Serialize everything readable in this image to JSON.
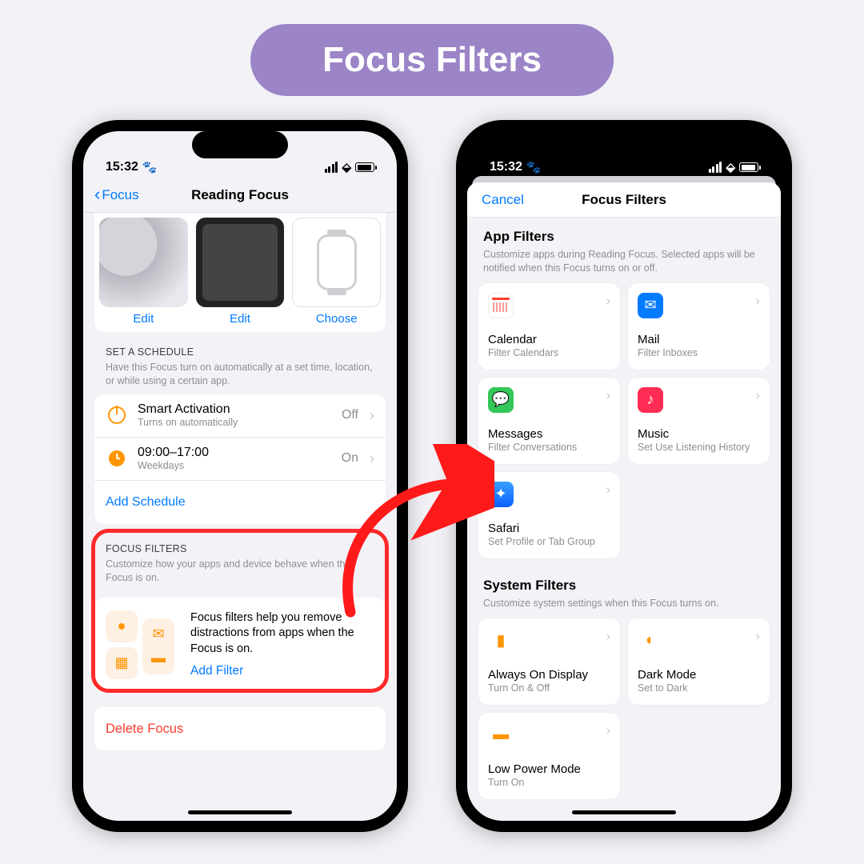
{
  "banner": "Focus Filters",
  "status_time": "15:32",
  "left": {
    "nav_back": "Focus",
    "nav_title": "Reading Focus",
    "previews": {
      "edit": "Edit",
      "choose": "Choose"
    },
    "schedule": {
      "header": "SET A SCHEDULE",
      "desc": "Have this Focus turn on automatically at a set time, location, or while using a certain app.",
      "smart": {
        "title": "Smart Activation",
        "sub": "Turns on automatically",
        "value": "Off"
      },
      "time": {
        "title": "09:00–17:00",
        "sub": "Weekdays",
        "value": "On"
      },
      "add": "Add Schedule"
    },
    "focus_filters": {
      "header": "FOCUS FILTERS",
      "desc": "Customize how your apps and device behave when this Focus is on.",
      "card_text": "Focus filters help you remove distractions from apps when the Focus is on.",
      "add": "Add Filter"
    },
    "delete": "Delete Focus"
  },
  "right": {
    "nav_cancel": "Cancel",
    "nav_title": "Focus Filters",
    "app_filters": {
      "title": "App Filters",
      "desc": "Customize apps during Reading Focus. Selected apps will be notified when this Focus turns on or off."
    },
    "tiles": {
      "calendar": {
        "name": "Calendar",
        "sub": "Filter Calendars"
      },
      "mail": {
        "name": "Mail",
        "sub": "Filter Inboxes"
      },
      "messages": {
        "name": "Messages",
        "sub": "Filter Conversations"
      },
      "music": {
        "name": "Music",
        "sub": "Set Use Listening History"
      },
      "safari": {
        "name": "Safari",
        "sub": "Set Profile or Tab Group"
      }
    },
    "system_filters": {
      "title": "System Filters",
      "desc": "Customize system settings when this Focus turns on."
    },
    "sys_tiles": {
      "aod": {
        "name": "Always On Display",
        "sub": "Turn On & Off"
      },
      "dark": {
        "name": "Dark Mode",
        "sub": "Set to Dark"
      },
      "lpm": {
        "name": "Low Power Mode",
        "sub": "Turn On"
      }
    }
  }
}
